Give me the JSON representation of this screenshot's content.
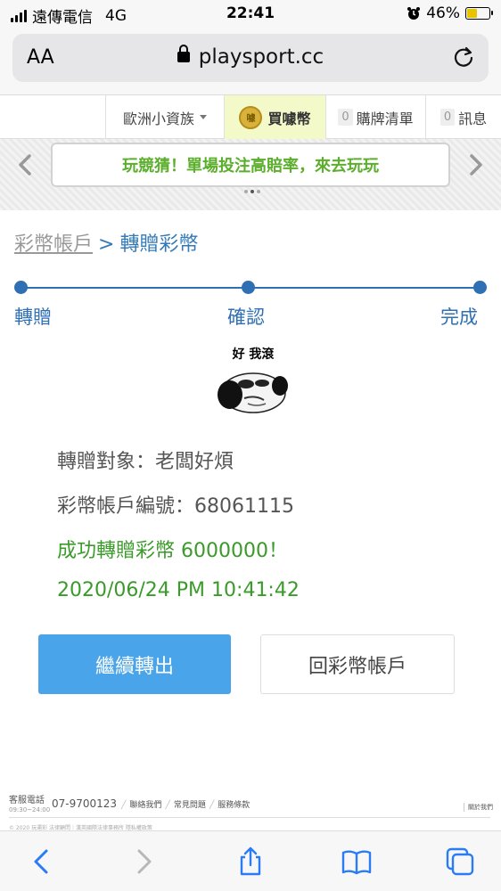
{
  "status_bar": {
    "carrier": "遠傳電信",
    "network": "4G",
    "time": "22:41",
    "battery": "46%",
    "battery_level": 0.46
  },
  "browser": {
    "text_size_label": "AA",
    "url": "playsport.cc"
  },
  "site_nav": {
    "member_name": "歐洲小資族",
    "buy_coins": "買噱幣",
    "coin_icon_text": "噱",
    "cart_count": "0",
    "cart_label": "購牌清單",
    "msg_count": "0",
    "msg_label": "訊息"
  },
  "banner": {
    "text": "玩競猜！單場投注高賠率，來去玩玩"
  },
  "breadcrumb": {
    "home": "彩幣帳戶",
    "separator": ">",
    "current": "轉贈彩幣"
  },
  "steps": [
    {
      "label": "轉贈"
    },
    {
      "label": "確認"
    },
    {
      "label": "完成"
    }
  ],
  "meme": {
    "caption": "好 我滾"
  },
  "result": {
    "recipient": "轉贈對象：老闆好煩",
    "account_no": "彩幣帳戶編號：68061115",
    "success_msg": "成功轉贈彩幣 6000000！",
    "timestamp": "2020/06/24 PM 10:41:42"
  },
  "buttons": {
    "continue": "繼續轉出",
    "back": "回彩幣帳戶"
  },
  "footer": {
    "service_label": "客服電話",
    "hours": "09:30~24:00",
    "phone": "07-9700123",
    "links": [
      "聯絡我們",
      "常見問題",
      "服務條款"
    ],
    "about": "關於我們",
    "copyright": "© 2020 玩運彩 法律顧問｜漢英國際法律事務所 隱私權政策"
  },
  "colors": {
    "primary": "#49a4ea",
    "link_blue": "#337ab7",
    "step_blue": "#2f6fb3",
    "success_green": "#3a9a2a",
    "banner_green": "#5cae2d"
  }
}
